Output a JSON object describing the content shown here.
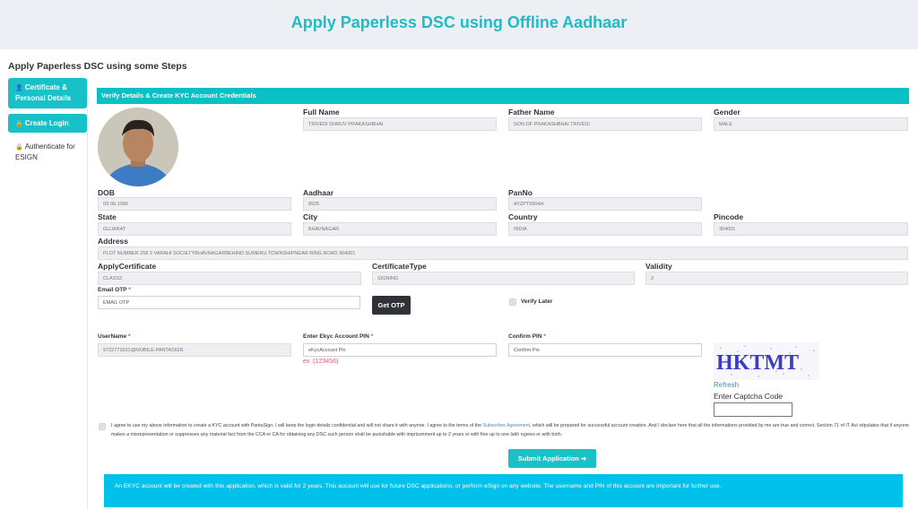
{
  "header": {
    "title": "Apply Paperless DSC using Offline Aadhaar"
  },
  "steps_title": "Apply Paperless DSC using some Steps",
  "sidebar": {
    "items": [
      {
        "icon": "user-icon",
        "label": "Certificate & Personal Details",
        "state": "active"
      },
      {
        "icon": "lock-icon",
        "label": "Create Login",
        "state": "active"
      },
      {
        "icon": "lock-icon",
        "label": "Authenticate for ESIGN",
        "state": "inactive"
      }
    ]
  },
  "panel": {
    "heading": "Verify Details & Create KYC Account Credentials"
  },
  "fields": {
    "full_name": {
      "label": "Full Name",
      "value": "TRIVEDI DHRUV PRAKASHBHAI"
    },
    "father_name": {
      "label": "Father Name",
      "value": "SON OF PRAKASHBHAI TRIVEDI"
    },
    "gender": {
      "label": "Gender",
      "value": "MALE"
    },
    "dob": {
      "label": "DOB",
      "value": "03-06-1996"
    },
    "aadhaar": {
      "label": "Aadhaar",
      "value": "8925"
    },
    "pan": {
      "label": "PanNo",
      "value": "AYZPT6904H"
    },
    "state": {
      "label": "State",
      "value": "GUJARAT"
    },
    "city": {
      "label": "City",
      "value": "BHAVNAGAR"
    },
    "country": {
      "label": "Country",
      "value": "INDIA"
    },
    "pincode": {
      "label": "Pincode",
      "value": "364001"
    },
    "address": {
      "label": "Address",
      "value": "PLOT NUMBER 258 2 VARAHI SOCIETYBHAVNAGARBEHIND SUMERU TOWNSHIPNEAR RING ROAD 364001"
    },
    "apply_certificate": {
      "label": "ApplyCertificate",
      "value": "CLASS3"
    },
    "certificate_type": {
      "label": "CertificateType",
      "value": "SIGNING"
    },
    "validity": {
      "label": "Validity",
      "value": "2"
    }
  },
  "otp": {
    "label": "Email OTP",
    "required_mark": "*",
    "placeholder": "EMAIL OTP",
    "button": "Get OTP",
    "verify_later_label": "Verify Later",
    "verify_later_checked": false
  },
  "credentials": {
    "username_label": "UserName",
    "username_value": "9722771601@MOBILE.PANTASIGN",
    "pin_label": "Enter Ekyc Account PIN",
    "pin_placeholder": "eKycAccount Pin",
    "pin_hint": "ex :(123456)",
    "confirm_label": "Confirm PIN",
    "confirm_placeholder": "Confirm Pin",
    "required_mark": "*"
  },
  "captcha": {
    "text": "HKTMT",
    "refresh": "Refresh",
    "label": "Enter Captcha Code",
    "value": ""
  },
  "agreement": {
    "checked": false,
    "text_before": "I agree to use my above information to create a KYC account with PantaSign. I will keep the login details confidential and will not share it with anyone. I agree to the terms of the ",
    "link": "Subscriber Agreement",
    "text_after": ", which will be prepared for successful account creation. And I declare here that all the informations provided by me are true and correct. Section 71 of IT Act stipulates that if anyone makes a misrepresentation or suppresses any material fact from the CCA or CA for obtaining any DSC such person shall be punishable with imprisonment up to 2 years or with fine up to one lakh rupees or with both."
  },
  "submit": {
    "label": "Submit Application",
    "icon": "arrow-right-icon"
  },
  "info": "An EKYC account will be created with this application, which is valid for 2 years. This account will use for future DSC applications, or perform eSign on any website. The username and PIN of this account are important for further use.",
  "colors": {
    "accent": "#08c0c6",
    "title": "#1ebdc6",
    "info_bg": "#00c0ec",
    "dark_button": "#2f3338"
  }
}
